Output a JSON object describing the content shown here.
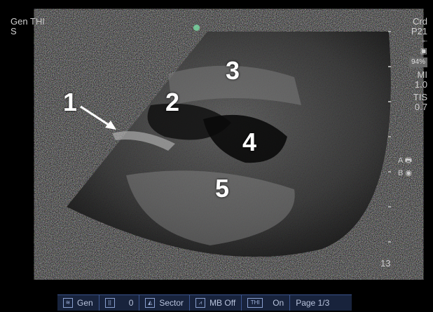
{
  "top_left": {
    "line1": "Gen  THI",
    "line2": "S"
  },
  "right_panel": {
    "mode": "Crd",
    "probe": "P21",
    "percent": "94%",
    "mi_label": "MI",
    "mi_value": "1.0",
    "tis_label": "TIS",
    "tis_value": "0.7",
    "a_label": "A",
    "b_label": "B"
  },
  "depth_value": "13",
  "labels": {
    "l1": "1",
    "l2": "2",
    "l3": "3",
    "l4": "4",
    "l5": "5"
  },
  "bottom_bar": {
    "gen": "Gen",
    "bars_value": "0",
    "sector": "Sector",
    "mb": "MB Off",
    "thi_label": "THI",
    "thi_value": "On",
    "page": "Page 1/3"
  },
  "colors": {
    "marker": "#2ecc71",
    "bar_bg": "#18233c",
    "bar_border": "#3b5590"
  }
}
